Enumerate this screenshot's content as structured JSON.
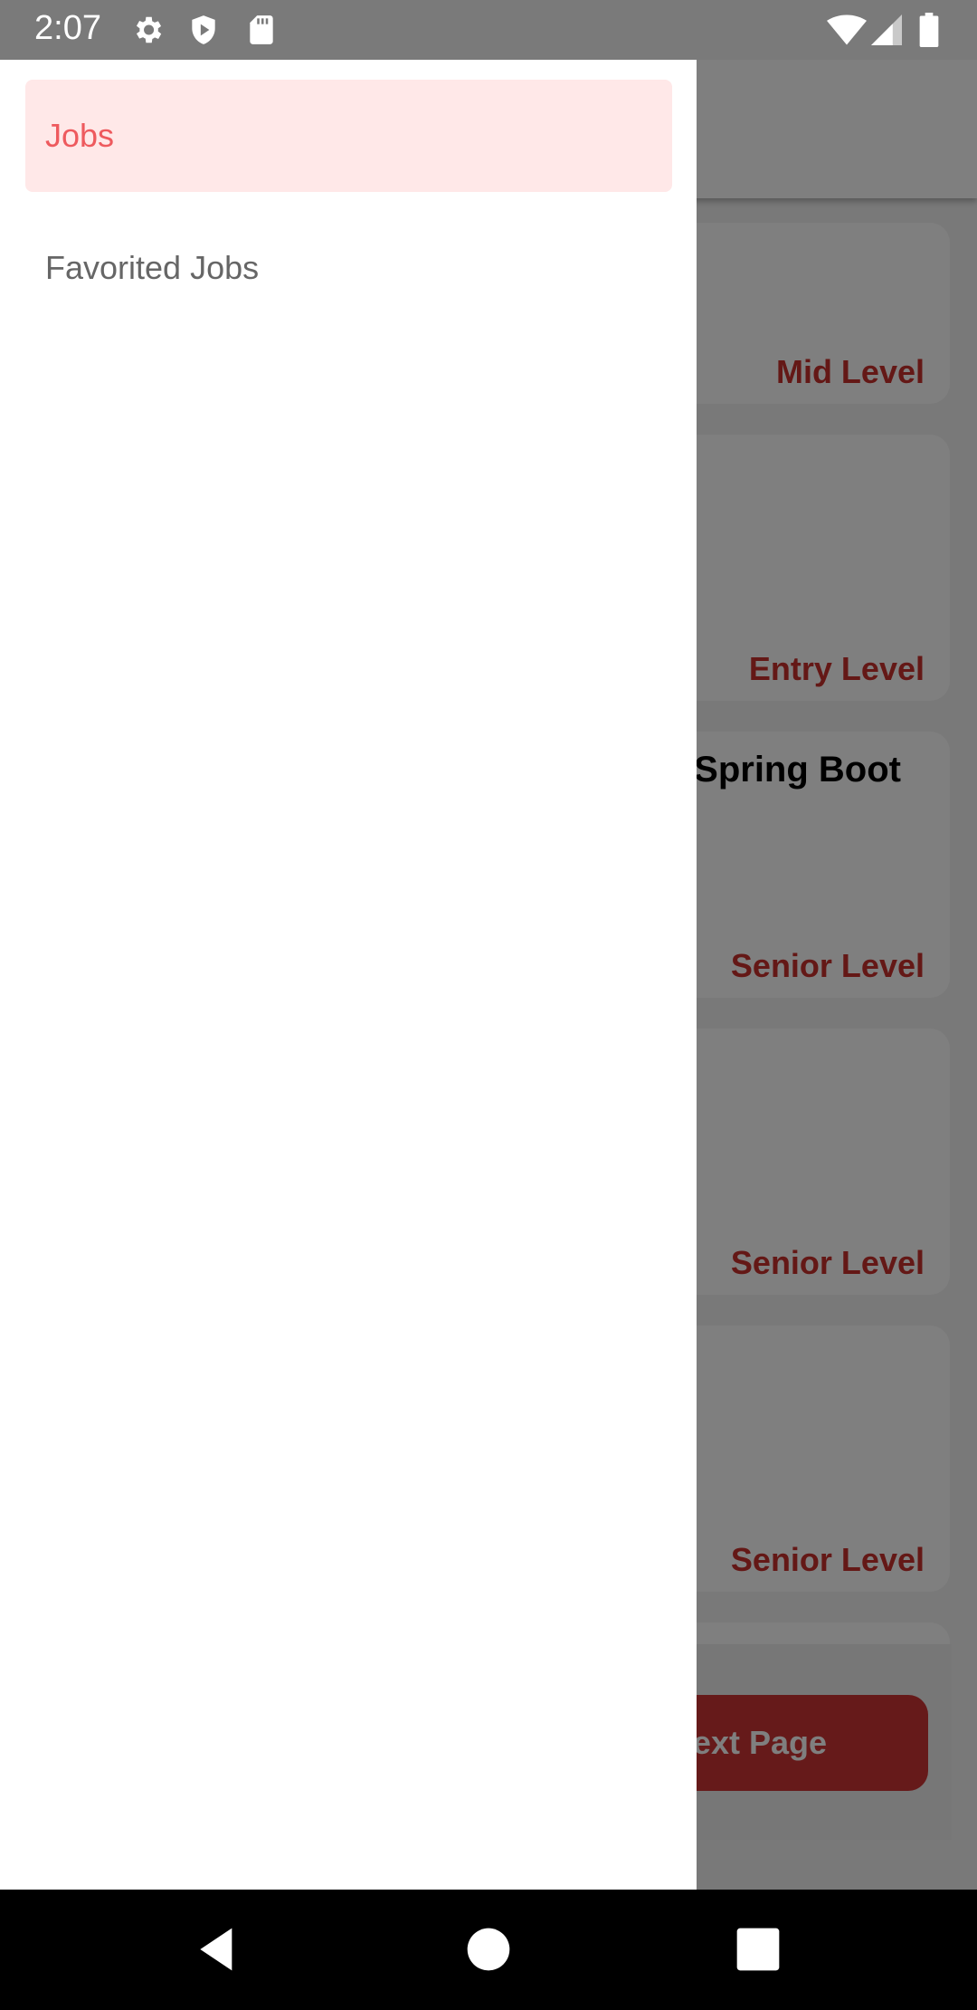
{
  "status_bar": {
    "time": "2:07"
  },
  "background": {
    "cards": [
      {
        "title": "",
        "level": "Mid Level"
      },
      {
        "title": "",
        "level": "Entry Level"
      },
      {
        "title": "Spring Boot",
        "level": "Senior Level"
      },
      {
        "title": "",
        "level": "Senior Level"
      },
      {
        "title": "",
        "level": "Senior Level"
      }
    ],
    "next_button_label": "ext Page"
  },
  "drawer": {
    "items": [
      {
        "label": "Jobs",
        "active": true
      },
      {
        "label": "Favorited Jobs",
        "active": false
      }
    ]
  },
  "colors": {
    "accent": "#ee5a5e",
    "active_bg": "#ffe8e8",
    "level_text": "#c9302c",
    "button": "#cd3434"
  },
  "icons": {
    "status": [
      "gear-icon",
      "shield-play-icon",
      "sd-card-icon",
      "wifi-icon",
      "signal-icon",
      "battery-icon"
    ],
    "nav": [
      "back-icon",
      "home-icon",
      "recents-icon"
    ]
  }
}
